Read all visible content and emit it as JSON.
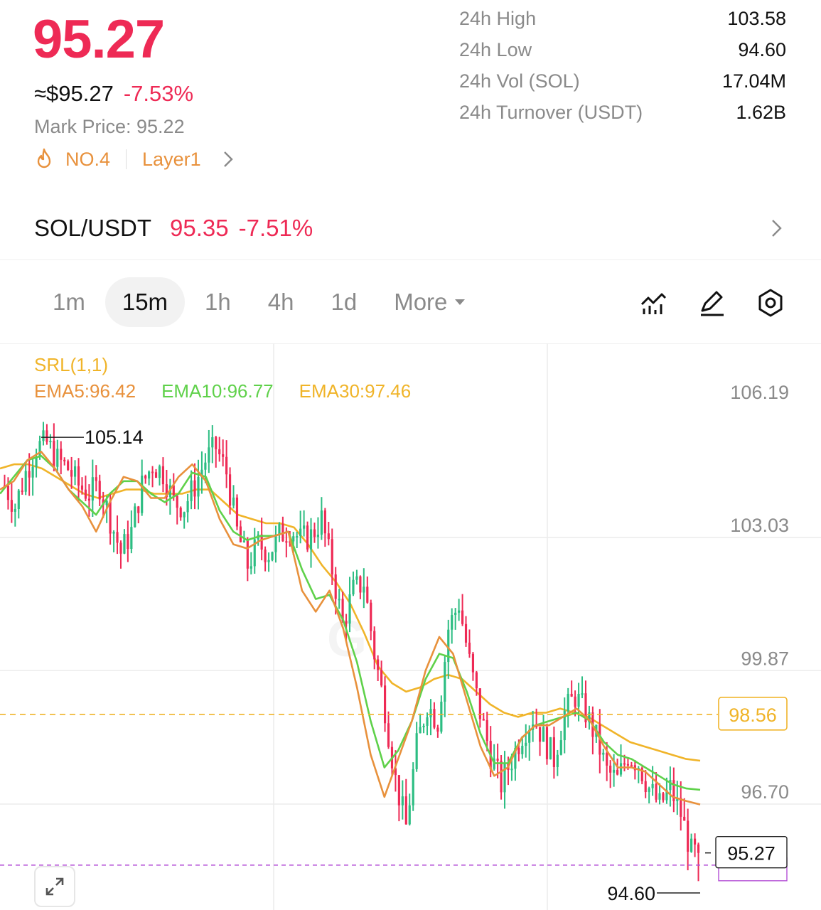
{
  "header": {
    "last_price": "95.27",
    "usd_price": "≈$95.27",
    "change_pct": "-7.53%",
    "mark_price": "Mark Price: 95.22",
    "rank": "NO.4",
    "category": "Layer1"
  },
  "stats": [
    {
      "label": "24h  High",
      "value": "103.58"
    },
    {
      "label": "24h  Low",
      "value": "94.60"
    },
    {
      "label": "24h  Vol (SOL)",
      "value": "17.04M"
    },
    {
      "label": "24h  Turnover (USDT)",
      "value": "1.62B"
    }
  ],
  "spot": {
    "pair": "SOL/USDT",
    "price": "95.35",
    "change": "-7.51%"
  },
  "timeframes": {
    "tabs": [
      "1m",
      "15m",
      "1h",
      "4h",
      "1d"
    ],
    "active": "15m",
    "more": "More"
  },
  "indicators": {
    "srl": "SRL(1,1)",
    "ema5": "EMA5:96.42",
    "ema10": "EMA10:96.77",
    "ema30": "EMA30:97.46"
  },
  "colors": {
    "up": "#2cbd82",
    "down": "#ee2a55",
    "ema5": "#e8913c",
    "ema10": "#5fd14a",
    "ema30": "#f0b429",
    "srl": "#f0b429",
    "gridline": "#ececec"
  },
  "chart_data": {
    "type": "candlestick",
    "interval": "15m",
    "y_ticks": [
      "106.19",
      "103.03",
      "99.87",
      "96.70"
    ],
    "ylim": [
      93.0,
      107.5
    ],
    "high_marker": "105.14",
    "low_marker": "94.60",
    "last_price_tag": "95.27",
    "srl_level": "98.56",
    "approx_close_path": [
      104.0,
      103.5,
      104.3,
      104.9,
      105.0,
      104.6,
      104.4,
      104.0,
      103.8,
      104.0,
      103.2,
      102.4,
      102.9,
      104.0,
      104.5,
      104.3,
      103.6,
      103.5,
      104.0,
      104.6,
      104.9,
      104.3,
      102.9,
      102.1,
      102.6,
      102.4,
      102.8,
      103.0,
      102.7,
      102.8,
      103.2,
      102.0,
      100.7,
      101.5,
      101.7,
      100.0,
      98.7,
      97.0,
      95.9,
      97.8,
      98.8,
      98.4,
      100.6,
      101.2,
      99.8,
      98.6,
      97.6,
      96.9,
      97.5,
      98.1,
      98.5,
      98.0,
      97.5,
      98.6,
      99.0,
      98.6,
      98.0,
      97.2,
      97.0,
      97.6,
      97.4,
      96.8,
      96.4,
      96.8,
      96.2,
      95.27
    ],
    "ema5_path": [
      103.9,
      104.1,
      104.6,
      104.8,
      104.4,
      103.9,
      103.5,
      102.9,
      103.6,
      104.2,
      104.1,
      103.7,
      103.7,
      104.2,
      104.5,
      104.1,
      103.2,
      102.6,
      102.5,
      102.7,
      102.8,
      102.9,
      101.5,
      101.0,
      101.5,
      100.6,
      99.2,
      97.6,
      96.6,
      97.5,
      98.4,
      99.6,
      100.4,
      100.0,
      98.9,
      97.8,
      97.1,
      97.3,
      98.0,
      98.3,
      98.3,
      98.5,
      98.7,
      98.4,
      97.8,
      97.3,
      97.3,
      97.2,
      96.9,
      96.6,
      96.5,
      96.42
    ],
    "ema10_path": [
      103.8,
      104.2,
      104.6,
      104.7,
      104.4,
      103.9,
      103.6,
      103.3,
      103.8,
      104.1,
      104.1,
      103.8,
      103.6,
      103.8,
      104.3,
      104.2,
      103.4,
      102.9,
      102.7,
      102.8,
      102.8,
      102.9,
      102.0,
      101.3,
      101.4,
      100.8,
      99.8,
      98.4,
      97.3,
      97.7,
      98.4,
      99.4,
      100.0,
      99.9,
      99.1,
      98.1,
      97.4,
      97.4,
      98.0,
      98.3,
      98.4,
      98.5,
      98.6,
      98.4,
      97.9,
      97.6,
      97.5,
      97.3,
      97.1,
      96.9,
      96.8,
      96.77
    ],
    "ema30_path": [
      104.4,
      104.5,
      104.5,
      104.4,
      104.2,
      104.0,
      103.8,
      103.7,
      103.8,
      103.9,
      103.9,
      103.8,
      103.8,
      103.8,
      103.9,
      103.9,
      103.6,
      103.3,
      103.2,
      103.1,
      103.1,
      103.0,
      102.6,
      102.1,
      101.7,
      101.2,
      100.5,
      99.7,
      99.3,
      99.1,
      99.2,
      99.4,
      99.5,
      99.4,
      99.1,
      98.8,
      98.6,
      98.5,
      98.6,
      98.6,
      98.7,
      98.6,
      98.5,
      98.3,
      98.1,
      97.9,
      97.8,
      97.7,
      97.6,
      97.5,
      97.46
    ]
  }
}
